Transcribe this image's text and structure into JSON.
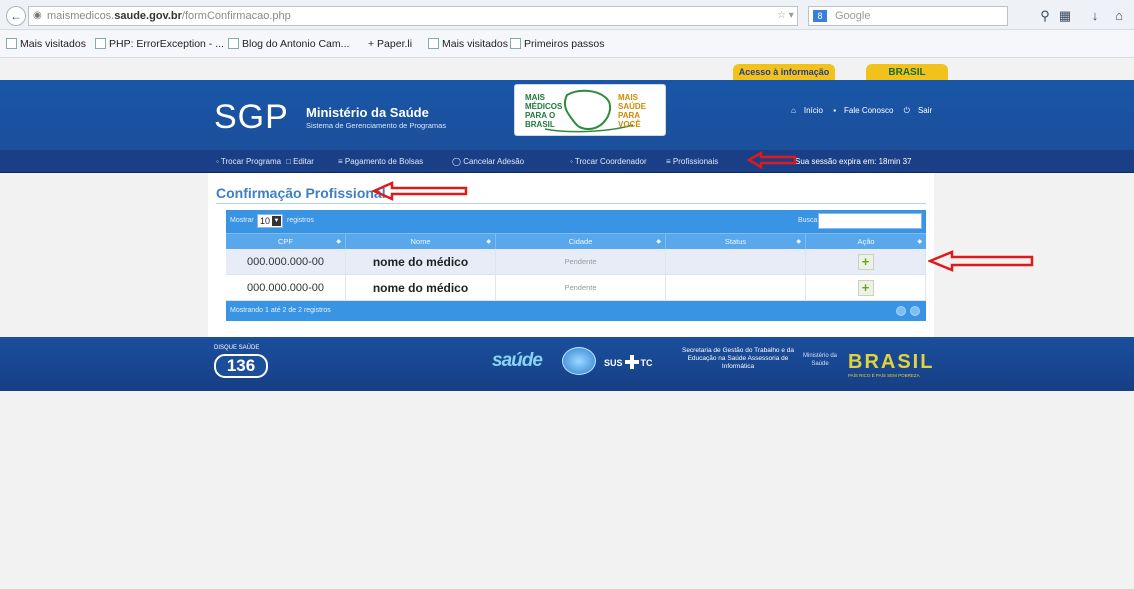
{
  "browser": {
    "url_prefix": "maismedicos.",
    "url_host": "saude.gov.br",
    "url_path": "/formConfirmacao.php",
    "url_tail": "☆ ▾ C",
    "search_placeholder": "Google",
    "search_engine_badge": "8"
  },
  "bookmarks": [
    {
      "label": "Mais visitados"
    },
    {
      "label": "PHP: ErrorException - ..."
    },
    {
      "label": "Blog do Antonio Cam..."
    },
    {
      "label": "+ Paper.li"
    },
    {
      "label": "Mais visitados"
    },
    {
      "label": "Primeiros passos"
    }
  ],
  "header": {
    "top_tab_acesso": "Acesso à informação",
    "top_tab_brasil": "BRASIL",
    "logo_text": "SGP",
    "ministry_title": "Ministério da Saúde",
    "ministry_subtitle": "Sistema de Gerenciamento de Programas",
    "program_logo_left": "MAIS MÉDICOS PARA O BRASIL",
    "program_logo_right": "MAIS SAÚDE PARA VOCÊ",
    "links": [
      "Início",
      "Fale Conosco",
      "Sair"
    ]
  },
  "nav": {
    "items": [
      "Trocar Programa",
      "Editar",
      "Pagamento de Bolsas",
      "Cancelar Adesão",
      "Trocar Coordenador",
      "Profissionais"
    ],
    "session_text": "Sua sessão expira em: 18min 37"
  },
  "main": {
    "title": "Confirmação Profissional",
    "table": {
      "show_label": "Mostrar",
      "show_value": "10",
      "records_label": "registros",
      "search_label": "Buscar:",
      "columns": [
        "CPF",
        "Nome",
        "Cidade",
        "Status",
        "Ação"
      ],
      "rows": [
        {
          "cpf": "000.000.000-00",
          "nome": "nome do médico",
          "cidade": "Pendente",
          "status": "",
          "acao": "+"
        },
        {
          "cpf": "000.000.000-00",
          "nome": "nome do médico",
          "cidade": "Pendente",
          "status": "",
          "acao": "+"
        }
      ],
      "footer_text": "Mostrando 1 até 2 de 2 registros"
    }
  },
  "footer": {
    "disque_label": "DISQUE SAÚDE",
    "disque_number": "136",
    "saude_logo": "saúde",
    "sus_label": "SUS",
    "sus_suffix": "TC",
    "secretaria": "Secretaria de Gestão do Trabalho e da Educação na Saúde Assessoria de Informática",
    "ministerio": "Ministério da Saúde",
    "brasil": "BRASIL",
    "brasil_slogan": "PAÍS RICO É PAÍS SEM POBREZA"
  },
  "colors": {
    "header_blue": "#1a56a7",
    "nav_blue": "#1a3f86",
    "table_blue": "#3a94e4",
    "title_blue": "#3f7fc4",
    "annotation_red": "#e01a1a",
    "gold": "#f1c21b"
  }
}
